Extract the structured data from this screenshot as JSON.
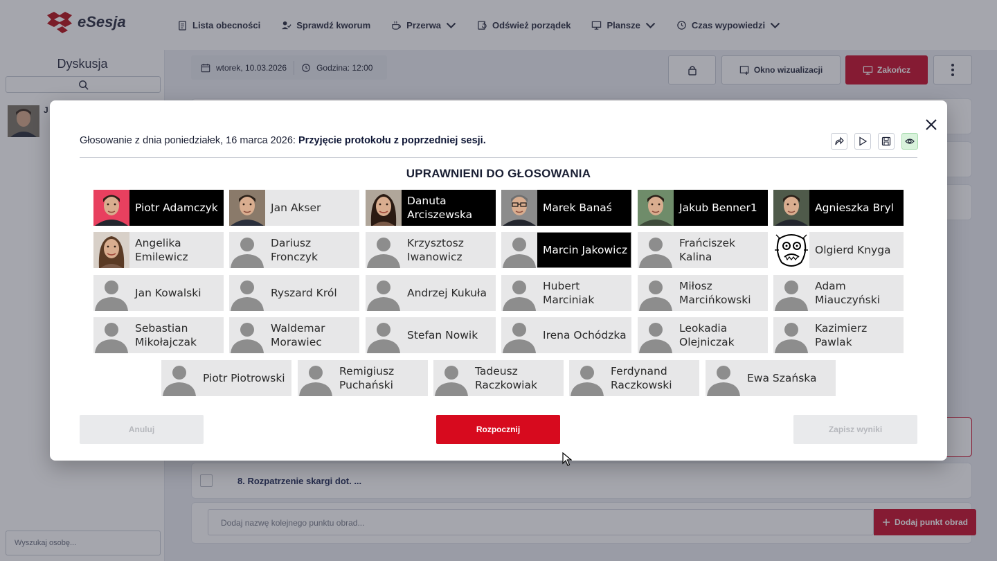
{
  "app": {
    "logo_text": "eSesja"
  },
  "nav": [
    {
      "label": "Lista obecności",
      "icon": "clipboard-icon",
      "has_dropdown": false
    },
    {
      "label": "Sprawdź kworum",
      "icon": "user-check-icon",
      "has_dropdown": false
    },
    {
      "label": "Przerwa",
      "icon": "coffee-icon",
      "has_dropdown": true
    },
    {
      "label": "Odśwież porządek",
      "icon": "refresh-doc-icon",
      "has_dropdown": false
    },
    {
      "label": "Plansze",
      "icon": "monitor-icon",
      "has_dropdown": true
    },
    {
      "label": "Czas wypowiedzi",
      "icon": "clock-icon",
      "has_dropdown": true
    }
  ],
  "sidebar": {
    "title": "Dyskusja",
    "first_speaker_initial": "J",
    "search_person_placeholder": "Wyszukaj osobę..."
  },
  "session": {
    "date": "wtorek, 10.03.2026",
    "time": "Godzina: 12:00",
    "visualization_button": "Okno wizualizacji",
    "end_button": "Zakończ"
  },
  "agenda": {
    "item8": "8.  Rozpatrzenie skargi dot. ...",
    "add_placeholder": "Dodaj nazwę kolejnego punktu obrad...",
    "add_button": "Dodaj punkt obrad"
  },
  "modal": {
    "title_prefix": "Głosowanie z dnia poniedziałek, 16 marca 2026:",
    "title_subject": "Przyjęcie protokołu z poprzedniej sesji.",
    "section_title": "UPRAWNIENI DO GŁOSOWANIA",
    "cancel_button": "Anuluj",
    "start_button": "Rozpocznij",
    "save_button": "Zapisz wyniki",
    "voters": [
      {
        "name": "Piotr Adamczyk",
        "selected": true,
        "photo": "man-dark-hair",
        "bg": "#e8405f"
      },
      {
        "name": "Jan Akser",
        "selected": false,
        "photo": "man-suit",
        "bg": "#8a7a6a"
      },
      {
        "name": "Danuta Arciszewska",
        "selected": true,
        "photo": "woman-dark-hair",
        "bg": "#b0a69a"
      },
      {
        "name": "Marek Banaś",
        "selected": true,
        "photo": "man-glasses",
        "bg": "#8c8c8c"
      },
      {
        "name": "Jakub Benner1",
        "selected": true,
        "photo": "man-outdoor",
        "bg": "#6f8c6a"
      },
      {
        "name": "Agnieszka Bryl",
        "selected": true,
        "photo": "man-short-hair",
        "bg": "#4f5a4a"
      },
      {
        "name": "Angelika Emilewicz",
        "selected": false,
        "photo": "woman-smiling",
        "bg": "#d8d0c8"
      },
      {
        "name": "Dariusz Fronczyk",
        "selected": false,
        "photo": "placeholder"
      },
      {
        "name": "Krzysztosz Iwanowicz",
        "selected": false,
        "photo": "placeholder"
      },
      {
        "name": "Marcin Jakowicz",
        "selected": true,
        "photo": "placeholder"
      },
      {
        "name": "Frańciszek Kalina",
        "selected": false,
        "photo": "placeholder"
      },
      {
        "name": "Olgierd Knyga",
        "selected": false,
        "photo": "sketch-face"
      },
      {
        "name": "Jan Kowalski",
        "selected": false,
        "photo": "placeholder"
      },
      {
        "name": "Ryszard Król",
        "selected": false,
        "photo": "placeholder"
      },
      {
        "name": "Andrzej Kukuła",
        "selected": false,
        "photo": "placeholder"
      },
      {
        "name": "Hubert Marciniak",
        "selected": false,
        "photo": "placeholder"
      },
      {
        "name": "Miłosz Marcińkowski",
        "selected": false,
        "photo": "placeholder"
      },
      {
        "name": "Adam Miauczyński",
        "selected": false,
        "photo": "placeholder"
      },
      {
        "name": "Sebastian Mikołajczak",
        "selected": false,
        "photo": "placeholder"
      },
      {
        "name": "Waldemar Morawiec",
        "selected": false,
        "photo": "placeholder"
      },
      {
        "name": "Stefan Nowik",
        "selected": false,
        "photo": "placeholder"
      },
      {
        "name": "Irena Ochódzka",
        "selected": false,
        "photo": "placeholder"
      },
      {
        "name": "Leokadia Olejniczak",
        "selected": false,
        "photo": "placeholder"
      },
      {
        "name": "Kazimierz Pawlak",
        "selected": false,
        "photo": "placeholder"
      },
      {
        "name": "Piotr Piotrowski",
        "selected": false,
        "photo": "placeholder"
      },
      {
        "name": "Remigiusz Puchański",
        "selected": false,
        "photo": "placeholder"
      },
      {
        "name": "Tadeusz Raczkowiak",
        "selected": false,
        "photo": "placeholder"
      },
      {
        "name": "Ferdynand Raczkowski",
        "selected": false,
        "photo": "placeholder"
      },
      {
        "name": "Ewa Szańska",
        "selected": false,
        "photo": "placeholder"
      }
    ]
  },
  "colors": {
    "accent_red": "#d70a1e",
    "brand_red": "#c8102e",
    "selected_tile": "#000000",
    "tile": "#e7e7e8"
  }
}
